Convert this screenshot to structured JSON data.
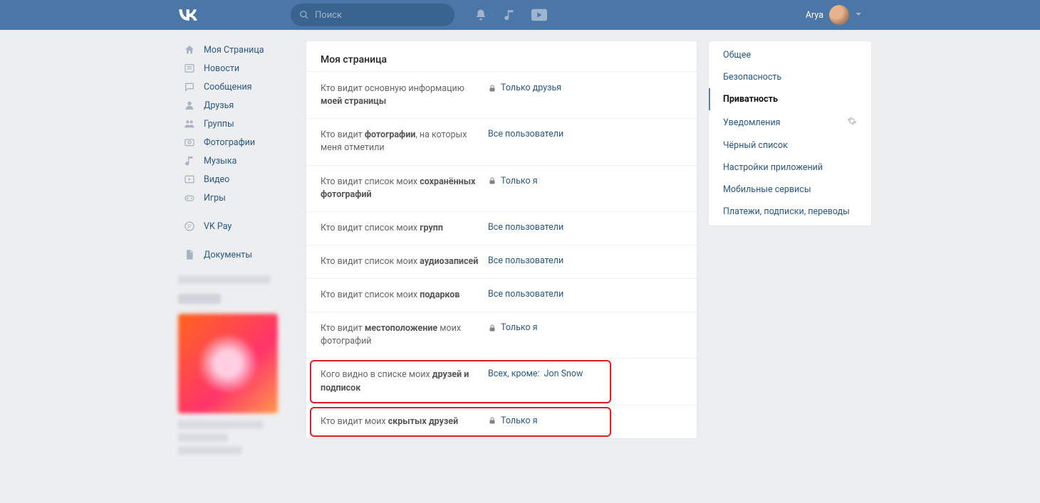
{
  "header": {
    "search_placeholder": "Поиск",
    "username": "Arya"
  },
  "sidebar": {
    "items": [
      {
        "label": "Моя Страница",
        "icon": "home"
      },
      {
        "label": "Новости",
        "icon": "news"
      },
      {
        "label": "Сообщения",
        "icon": "msg"
      },
      {
        "label": "Друзья",
        "icon": "friend"
      },
      {
        "label": "Группы",
        "icon": "groups"
      },
      {
        "label": "Фотографии",
        "icon": "photo"
      },
      {
        "label": "Музыка",
        "icon": "music"
      },
      {
        "label": "Видео",
        "icon": "video"
      },
      {
        "label": "Игры",
        "icon": "games"
      }
    ],
    "extra": [
      {
        "label": "VK Pay",
        "icon": "pay"
      },
      {
        "label": "Документы",
        "icon": "docs"
      }
    ]
  },
  "main": {
    "title": "Моя страница",
    "rows": [
      {
        "label_pre": "Кто видит основную информацию ",
        "label_bold": "моей страницы",
        "label_post": "",
        "lock": true,
        "value": "Только друзья",
        "extra": ""
      },
      {
        "label_pre": "Кто видит ",
        "label_bold": "фотографии",
        "label_post": ", на которых меня отметили",
        "lock": false,
        "value": "Все пользователи",
        "extra": ""
      },
      {
        "label_pre": "Кто видит список моих ",
        "label_bold": "сохранённых фотографий",
        "label_post": "",
        "lock": true,
        "value": "Только я",
        "extra": ""
      },
      {
        "label_pre": "Кто видит список моих ",
        "label_bold": "групп",
        "label_post": "",
        "lock": false,
        "value": "Все пользователи",
        "extra": ""
      },
      {
        "label_pre": "Кто видит список моих ",
        "label_bold": "аудиозаписей",
        "label_post": "",
        "lock": false,
        "value": "Все пользователи",
        "extra": ""
      },
      {
        "label_pre": "Кто видит список моих ",
        "label_bold": "подарков",
        "label_post": "",
        "lock": false,
        "value": "Все пользователи",
        "extra": ""
      },
      {
        "label_pre": "Кто видит ",
        "label_bold": "местоположение",
        "label_post": " моих фотографий",
        "lock": true,
        "value": "Только я",
        "extra": ""
      },
      {
        "label_pre": "Кого видно в списке моих ",
        "label_bold": "друзей и подписок",
        "label_post": "",
        "lock": false,
        "value": "Всех, кроме:",
        "extra": "Jon Snow",
        "highlight": true
      },
      {
        "label_pre": "Кто видит моих ",
        "label_bold": "скрытых друзей",
        "label_post": "",
        "lock": true,
        "value": "Только я",
        "extra": "",
        "highlight": true
      }
    ]
  },
  "right": {
    "items": [
      {
        "label": "Общее"
      },
      {
        "label": "Безопасность"
      },
      {
        "label": "Приватность",
        "active": true
      },
      {
        "label": "Уведомления",
        "gear": true
      },
      {
        "label": "Чёрный список"
      },
      {
        "label": "Настройки приложений"
      },
      {
        "label": "Мобильные сервисы"
      },
      {
        "label": "Платежи, подписки, переводы"
      }
    ]
  }
}
